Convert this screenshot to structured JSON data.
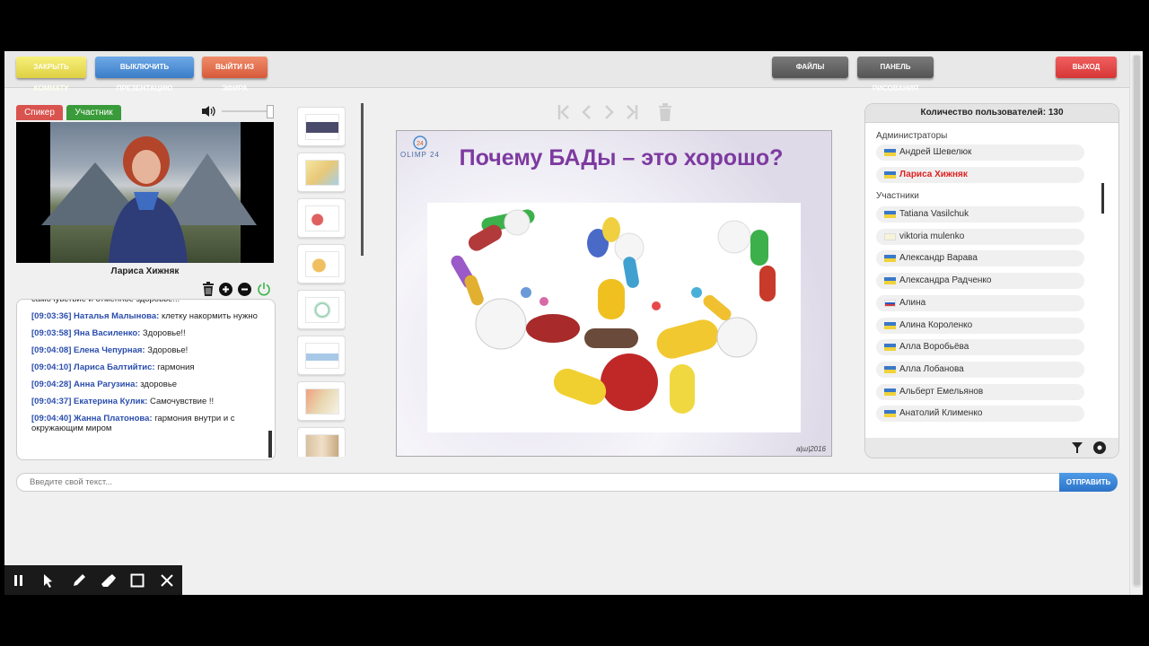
{
  "toolbar": {
    "close_room": "ЗАКРЫТЬ КОМНАТУ",
    "disable_presentation": "ВЫКЛЮЧИТЬ ПРЕЗЕНТАЦИЮ",
    "leave_broadcast": "ВЫЙТИ ИЗ ЭФИРА",
    "files": "ФАЙЛЫ",
    "drawing_panel": "ПАНЕЛЬ РИСОВАНИЯ",
    "exit": "ВЫХОД"
  },
  "tabs": {
    "speaker": "Спикер",
    "participant": "Участник"
  },
  "speaker": {
    "name": "Лариса Хижняк"
  },
  "chat": {
    "messages": [
      {
        "time": "",
        "name": "",
        "text": "самочувствие и отменное здоровье!!!"
      },
      {
        "time": "[09:03:36]",
        "name": "Наталья Малынова:",
        "text": " клетку накормить нужно"
      },
      {
        "time": "[09:03:58]",
        "name": "Яна Василенко:",
        "text": " Здоровье!!"
      },
      {
        "time": "[09:04:08]",
        "name": "Елена Чепурная:",
        "text": " Здоровье!"
      },
      {
        "time": "[09:04:10]",
        "name": "Лариса Балтийтис:",
        "text": " гармония"
      },
      {
        "time": "[09:04:28]",
        "name": "Анна Рагузина:",
        "text": " здоровье"
      },
      {
        "time": "[09:04:37]",
        "name": "Екатерина Кулик:",
        "text": " Самочувствие !!"
      },
      {
        "time": "[09:04:40]",
        "name": "Жанна Платонова:",
        "text": " гармония внутри и с окружающим миром"
      }
    ]
  },
  "slide": {
    "title": "Почему БАДы – это хорошо?",
    "logo": "OLIMP 24",
    "footer": "а|ш|2016"
  },
  "users": {
    "count_label": "Количество пользователей: 130",
    "admins_label": "Администраторы",
    "participants_label": "Участники",
    "admins": [
      {
        "name": "Андрей Шевелюк",
        "flag": "ua",
        "highlight": false
      },
      {
        "name": "Лариса Хижняк",
        "flag": "ua",
        "highlight": true
      }
    ],
    "participants": [
      {
        "name": "Tatiana Vasilchuk",
        "flag": "ua"
      },
      {
        "name": "viktoria mulenko",
        "flag": "other"
      },
      {
        "name": "Александр Варава",
        "flag": "ua"
      },
      {
        "name": "Александра Радченко",
        "flag": "ua"
      },
      {
        "name": "Алина",
        "flag": "ru"
      },
      {
        "name": "Алина Короленко",
        "flag": "ua"
      },
      {
        "name": "Алла Воробьёва",
        "flag": "ua"
      },
      {
        "name": "Алла Лобанова",
        "flag": "ua"
      },
      {
        "name": "Альберт Емельянов",
        "flag": "ua"
      },
      {
        "name": "Анатолий Клименко",
        "flag": "ua"
      }
    ]
  },
  "input": {
    "placeholder": "Введите свой текст..."
  },
  "send_label": "ОТПРАВИТЬ",
  "colors": {
    "accent_blue": "#2d74c8",
    "speaker_tab": "#d9534f",
    "participant_tab": "#3a9b3a",
    "slide_title": "#7d3aa0",
    "highlight_user": "#e02020"
  }
}
